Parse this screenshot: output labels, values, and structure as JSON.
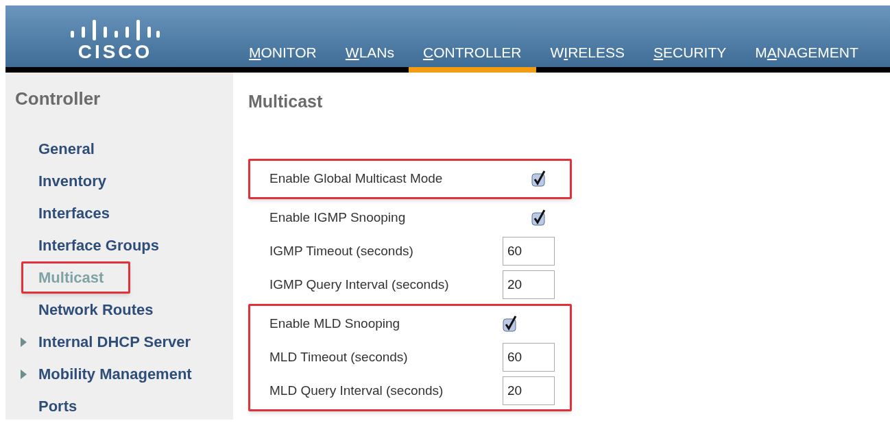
{
  "header": {
    "logo_text": "CISCO",
    "tabs": [
      {
        "key": "M",
        "rest": "ONITOR",
        "selected": false
      },
      {
        "key": "W",
        "rest": "LANs",
        "selected": false
      },
      {
        "key": "C",
        "rest": "ONTROLLER",
        "selected": true
      },
      {
        "key": "I",
        "rest": "RELESS",
        "prefix": "W",
        "selected": false
      },
      {
        "key": "S",
        "rest": "ECURITY",
        "selected": false
      },
      {
        "key": "A",
        "rest": "NAGEMENT",
        "prefix": "M",
        "selected": false
      }
    ]
  },
  "sidebar": {
    "title": "Controller",
    "items": [
      {
        "label": "General",
        "selected": false,
        "expandable": false,
        "highlighted": false
      },
      {
        "label": "Inventory",
        "selected": false,
        "expandable": false,
        "highlighted": false
      },
      {
        "label": "Interfaces",
        "selected": false,
        "expandable": false,
        "highlighted": false
      },
      {
        "label": "Interface Groups",
        "selected": false,
        "expandable": false,
        "highlighted": false
      },
      {
        "label": "Multicast",
        "selected": true,
        "expandable": false,
        "highlighted": true
      },
      {
        "label": "Network Routes",
        "selected": false,
        "expandable": false,
        "highlighted": false
      },
      {
        "label": "Internal DHCP Server",
        "selected": false,
        "expandable": true,
        "highlighted": false
      },
      {
        "label": "Mobility Management",
        "selected": false,
        "expandable": true,
        "highlighted": false
      },
      {
        "label": "Ports",
        "selected": false,
        "expandable": false,
        "highlighted": false
      }
    ]
  },
  "content": {
    "title": "Multicast",
    "groups": [
      {
        "highlighted": true,
        "rows": [
          {
            "kind": "checkbox",
            "label": "Enable Global Multicast Mode",
            "checked": true
          }
        ]
      },
      {
        "highlighted": false,
        "rows": [
          {
            "kind": "checkbox",
            "label": "Enable IGMP Snooping",
            "checked": true
          },
          {
            "kind": "input",
            "label": "IGMP Timeout (seconds)",
            "value": "60"
          },
          {
            "kind": "input",
            "label": "IGMP Query Interval (seconds)",
            "value": "20"
          }
        ]
      },
      {
        "highlighted": true,
        "rows": [
          {
            "kind": "checkbox",
            "label": "Enable MLD Snooping",
            "checked": true
          },
          {
            "kind": "input",
            "label": "MLD Timeout (seconds)",
            "value": "60"
          },
          {
            "kind": "input",
            "label": "MLD Query Interval (seconds)",
            "value": "20"
          }
        ]
      }
    ]
  }
}
